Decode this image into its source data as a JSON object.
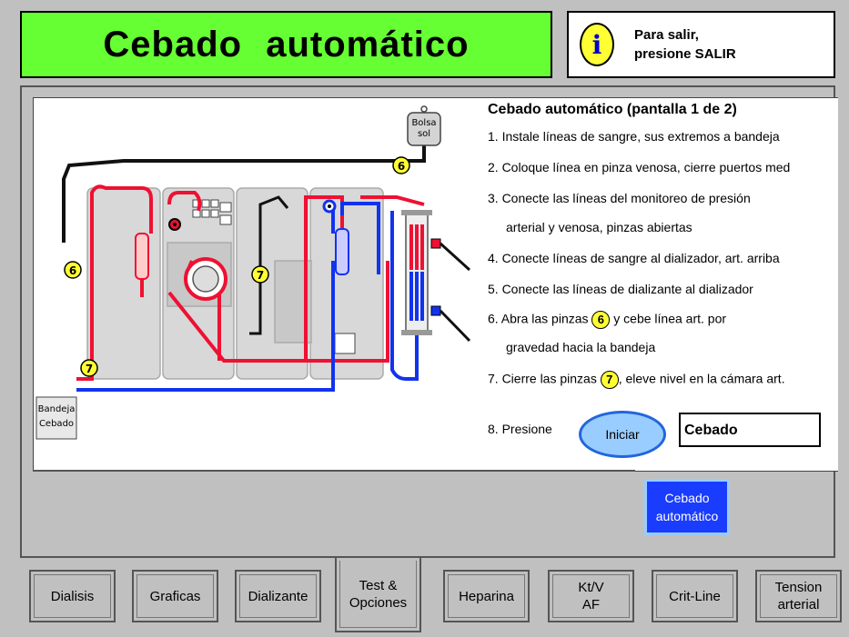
{
  "header": {
    "title": "Cebado automático",
    "info_line1": "Para salir,",
    "info_line2": "presione SALIR",
    "info_icon": "info-icon"
  },
  "diagram": {
    "bag_label_line1": "Bolsa",
    "bag_label_line2": "sol",
    "tray_label_line1": "Bandeja",
    "tray_label_line2": "Cebado",
    "clamp_6": "6",
    "clamp_7": "7",
    "arterial_color": "#ee1133",
    "venous_color": "#1133ee"
  },
  "instructions": {
    "title": "Cebado automático  (pantalla  1 de 2)",
    "step1": "1.  Instale líneas de sangre, sus extremos a bandeja",
    "step2": "2.  Coloque línea en pinza venosa, cierre puertos med",
    "step3a": "3.  Conecte las líneas del monitoreo de presión",
    "step3b": "arterial y venosa, pinzas abiertas",
    "step4": "4.  Conecte líneas de sangre al dializador, art. arriba",
    "step5": "5.  Conecte las líneas de dializante al dializador",
    "step6a_pre": "6.  Abra las pinzas",
    "step6a_num": "6",
    "step6a_post": "y cebe línea art. por",
    "step6b": "gravedad hacia la bandeja",
    "step7_pre": "7.  Cierre las pinzas",
    "step7_num": "7",
    "step7_post": ", eleve nivel en la cámara art.",
    "step8": "8.  Presione"
  },
  "controls": {
    "iniciar_label": "Iniciar",
    "status_value": "Cebado",
    "mode_line1": "Cebado",
    "mode_line2": "automático"
  },
  "tabs": [
    {
      "line1": "Dialisis",
      "line2": ""
    },
    {
      "line1": "Graficas",
      "line2": ""
    },
    {
      "line1": "Dializante",
      "line2": ""
    },
    {
      "line1": "Test &",
      "line2": "Opciones"
    },
    {
      "line1": "Heparina",
      "line2": ""
    },
    {
      "line1": "Kt/V",
      "line2": "AF"
    },
    {
      "line1": "Crit-Line",
      "line2": ""
    },
    {
      "line1": "Tension",
      "line2": "arterial"
    }
  ],
  "active_tab": "Test & Opciones"
}
